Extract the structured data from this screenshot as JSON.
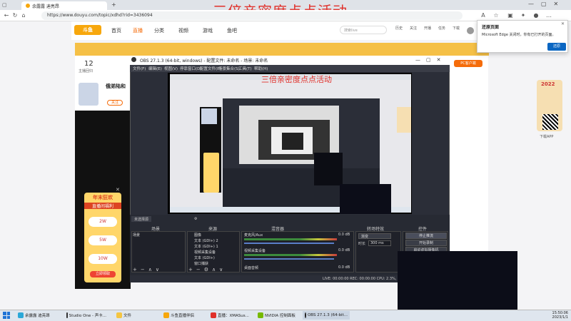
{
  "watermark": "三倍亲密度点点活动",
  "browser": {
    "tabs": [
      {
        "label": "余露露 迪亮昂"
      },
      {
        "label": ""
      }
    ],
    "url": "https://www.douyu.com/topic/xdhd?rid=3436094",
    "nav": [
      "首页",
      "直播",
      "分类",
      "视频",
      "游戏",
      "鱼吧"
    ],
    "logo": "斗鱼",
    "search_placeholder": "搜索live",
    "header_icons": [
      "历史",
      "关注",
      "开播",
      "任务",
      "下载"
    ]
  },
  "edge_popup": {
    "title": "还原页面",
    "text": "Microsoft Edge 关闭时，你有已打开的页面。",
    "button": "还原"
  },
  "left": {
    "count": "12",
    "count_label": "主播回归",
    "streamer_name": "俄弟陆和",
    "follow_label": "关注"
  },
  "promo": {
    "title": "年末狂欢",
    "subtitle": "直播间福利",
    "items": [
      "2W",
      "5W",
      "10W"
    ],
    "cta": "立即领取"
  },
  "right_side": {
    "pc_label": "PC客户端",
    "gift_year": "2022",
    "app_label": "下载APP"
  },
  "obs": {
    "title": "OBS 27.1.3 (64-bit, windows) - 配置文件: 未命名 - 场景: 未命名",
    "menu": [
      "文件(F)",
      "编辑(E)",
      "视图(V)",
      "停靠窗口(D)",
      "配置文件(P)",
      "场景集合(S)",
      "工具(T)",
      "帮助(H)"
    ],
    "scenes_title": "场景",
    "scenes": [
      "场景"
    ],
    "sources_title": "来源",
    "sources": [
      "图像",
      "文本 (GDI+) 2",
      "文本 (GDI+) 1",
      "视频采集设备",
      "文本 (GDI+)",
      "窗口捕获"
    ],
    "mixer_title": "混音器",
    "mixer": [
      {
        "name": "麦克风/Aux",
        "db": "0.0 dB"
      },
      {
        "name": "视频采集设备",
        "db": "0.0 dB"
      },
      {
        "name": "桌面音频",
        "db": "0.0 dB"
      }
    ],
    "transitions_title": "转场特效",
    "transition": "渐变",
    "duration_label": "时长",
    "duration": "300 ms",
    "controls_title": "控件",
    "controls": [
      "停止推流",
      "开始录制",
      "启动虚拟摄像机",
      "工作室模式",
      "设置",
      "退出"
    ],
    "status": "LIVE: 00:00:00   REC: 00:00:00   CPU: 2.3%, 30.00 fps",
    "preview_tab": "未选择源"
  },
  "taskbar": {
    "items": [
      "余露露 迪亮昂",
      "Studio One - 声卡...",
      "文件",
      "斗鱼直播伴侣",
      "直播：XMASus...",
      "NVIDIA 控制面板",
      "OBS 27.1.3 (64-bit..."
    ],
    "time": "15:50:06",
    "date": "2023/1/1"
  }
}
